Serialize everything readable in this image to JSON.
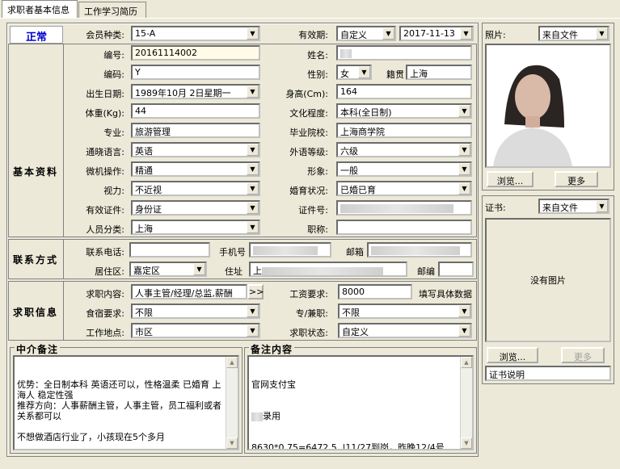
{
  "tabs": [
    {
      "label": "求职者基本信息"
    },
    {
      "label": "工作学习简历"
    }
  ],
  "status": {
    "label": "正常"
  },
  "member": {
    "type_label": "会员种类:",
    "type_value": "15-A",
    "validity_label": "有效期:",
    "validity_type": "自定义",
    "validity_date": "2017-11-13"
  },
  "sections": {
    "basic": "基本资料",
    "contact": "联系方式",
    "job": "求职信息"
  },
  "basic": {
    "id_label": "编号:",
    "id_value": "20161114002",
    "name_label": "姓名:",
    "code_label": "编码:",
    "code_value": "Y",
    "gender_label": "性别:",
    "gender_value": "女",
    "origin_label": "籍贯",
    "origin_value": "上海",
    "birth_label": "出生日期:",
    "birth_value": "1989年10月 2日星期一",
    "height_label": "身高(Cm):",
    "height_value": "164",
    "weight_label": "体重(Kg):",
    "weight_value": "44",
    "edu_label": "文化程度:",
    "edu_value": "本科(全日制)",
    "major_label": "专业:",
    "major_value": "旅游管理",
    "school_label": "毕业院校:",
    "school_value": "上海商学院",
    "lang_label": "通晓语言:",
    "lang_value": "英语",
    "langlevel_label": "外语等级:",
    "langlevel_value": "六级",
    "pc_label": "微机操作:",
    "pc_value": "精通",
    "image_label": "形象:",
    "image_value": "一般",
    "vision_label": "视力:",
    "vision_value": "不近视",
    "marital_label": "婚育状况:",
    "marital_value": "已婚已育",
    "cert_label": "有效证件:",
    "cert_value": "身份证",
    "certno_label": "证件号:",
    "category_label": "人员分类:",
    "category_value": "上海",
    "title_label": "职称:"
  },
  "contact": {
    "phone_label": "联系电话:",
    "mobile_label": "手机号",
    "email_label": "邮箱",
    "district_label": "居住区:",
    "district_value": "嘉定区",
    "address_label": "住址",
    "address_prefix": "上",
    "zip_label": "邮编"
  },
  "job": {
    "content_label": "求职内容:",
    "content_value": "人事主管/经理/总监,薪酬",
    "more_btn": ">>",
    "salary_label": "工资要求:",
    "salary_value": "8000",
    "salary_hint": "填写具体数据",
    "board_label": "食宿要求:",
    "board_value": "不限",
    "parttime_label": "专/兼职:",
    "parttime_value": "不限",
    "location_label": "工作地点:",
    "location_value": "市区",
    "jobstatus_label": "求职状态:",
    "jobstatus_value": "自定义"
  },
  "notes": {
    "agency_title": "中介备注",
    "agency_text": "优势：全日制本科 英语还可以，性格温柔 已婚育 上海人 稳定性强\n推荐方向：人事薪酬主管，人事主管，员工福利或者关系都可以\n\n不想做酒店行业了，小孩现在5个多月",
    "remark_title": "备注内容",
    "remark_line1": "官网支付宝",
    "remark_line2": "录用",
    "remark_line3": "8630*0.75=6472.5  |11/27到岗，昨晚12/4号"
  },
  "photo": {
    "label": "照片:",
    "source": "来自文件",
    "browse_btn": "浏览...",
    "more_btn": "更多"
  },
  "certificate": {
    "label": "证书:",
    "source": "来自文件",
    "empty_text": "没有图片",
    "browse_btn": "浏览...",
    "more_btn": "更多",
    "desc_value": "证书说明"
  }
}
